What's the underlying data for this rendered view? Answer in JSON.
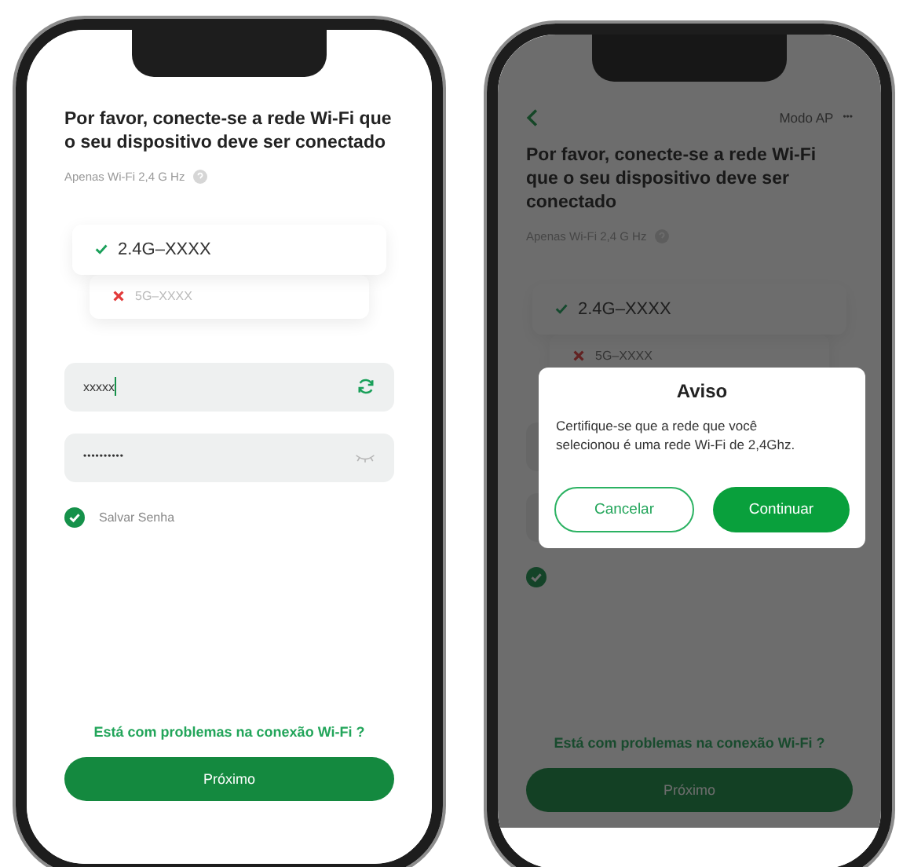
{
  "phones": [
    {
      "title": "Por favor, conecte-se a rede Wi-Fi que o seu dispositivo deve ser conectado",
      "note": "Apenas Wi-Fi 2,4 G Hz",
      "networks": [
        {
          "name": "2.4G–XXXX",
          "supported": true
        },
        {
          "name": "5G–XXXX",
          "supported": false
        }
      ],
      "ssid_field": {
        "value": "xxxxx"
      },
      "password_field": {
        "value": "••••••••••"
      },
      "save_password": {
        "label": "Salvar Senha",
        "checked": true
      },
      "help_link": "Está com problemas na conexão Wi-Fi ?",
      "next_button": "Próximo"
    },
    {
      "nav": {
        "mode": "Modo AP",
        "more": "•••"
      },
      "title": "Por favor, conecte-se a rede Wi-Fi que o seu dispositivo deve ser conectado",
      "note": "Apenas Wi-Fi 2,4 G Hz",
      "networks": [
        {
          "name": "2.4G–XXXX",
          "supported": true
        },
        {
          "name": "5G–XXXX",
          "supported": false
        }
      ],
      "save_password": {
        "checked": true
      },
      "help_link": "Está com problemas na conexão Wi-Fi ?",
      "next_button": "Próximo",
      "dialog": {
        "title": "Aviso",
        "message": "Certifique-se que a rede que você selecionou é uma rede Wi-Fi de 2,4Ghz.",
        "buttons": [
          {
            "label": "Cancelar",
            "kind": "outline"
          },
          {
            "label": "Continuar",
            "kind": "filled"
          }
        ]
      }
    }
  ]
}
